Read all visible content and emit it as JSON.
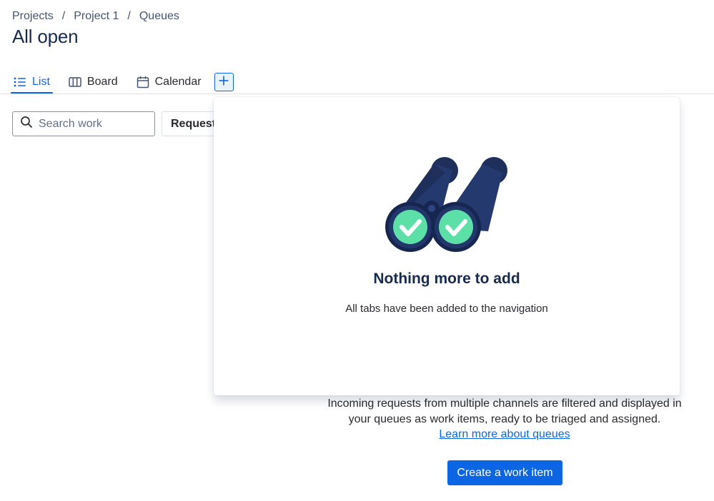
{
  "breadcrumb": {
    "items": [
      "Projects",
      "Project 1",
      "Queues"
    ],
    "separator": "/"
  },
  "page": {
    "title": "All open"
  },
  "tabs": [
    {
      "label": "List",
      "icon": "list-icon",
      "active": true
    },
    {
      "label": "Board",
      "icon": "board-icon",
      "active": false
    },
    {
      "label": "Calendar",
      "icon": "calendar-icon",
      "active": false
    }
  ],
  "add_tab": {
    "icon": "plus-icon"
  },
  "toolbar": {
    "search": {
      "placeholder": "Search work",
      "value": ""
    },
    "filter_label": "Request"
  },
  "empty_state": {
    "description_line1": "Incoming requests from multiple channels are filtered and displayed in",
    "description_line2": "your queues as work items, ready to be triaged and assigned.",
    "link_label": "Learn more about queues",
    "button_label": "Create a work item"
  },
  "popup": {
    "title": "Nothing more to add",
    "description": "All tabs have been added to the navigation",
    "illustration": "binoculars-check-icon"
  },
  "colors": {
    "accent": "#0c66e4",
    "text": "#292a2e",
    "heading": "#172b4d",
    "illustration_navy": "#1e2f5c",
    "illustration_check": "#5ce0a8"
  }
}
